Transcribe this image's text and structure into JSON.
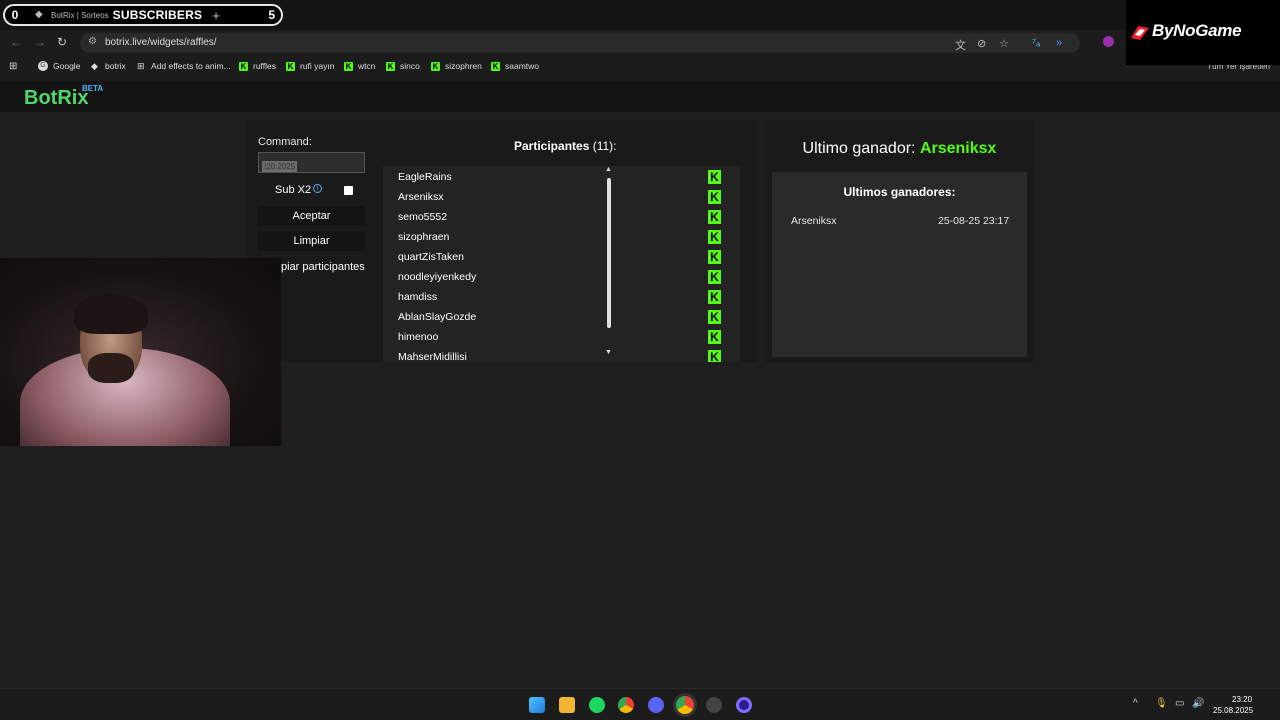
{
  "browser": {
    "subscribers_overlay": {
      "left_count": "0",
      "label": "SUBSCRIBERS",
      "right_count": "5"
    },
    "tab": {
      "title": "BotRix | Sorteos",
      "new_tab": "+"
    },
    "nav": {
      "back": "←",
      "forward": "→",
      "reload": "↻"
    },
    "url": "botrix.live/widgets/raffles/",
    "bookmarks": [
      {
        "label": "Google",
        "icon": "google-icon"
      },
      {
        "label": "botrix",
        "icon": "diamond-icon"
      },
      {
        "label": "Add effects to anim...",
        "icon": "plus-square-icon"
      },
      {
        "label": "ruffles",
        "icon": "kick-icon"
      },
      {
        "label": "rufi yayın",
        "icon": "kick-icon"
      },
      {
        "label": "wtcn",
        "icon": "kick-icon"
      },
      {
        "label": "sinco",
        "icon": "kick-icon"
      },
      {
        "label": "sizophren",
        "icon": "kick-icon"
      },
      {
        "label": "saamtwo",
        "icon": "kick-icon"
      }
    ],
    "all_bookmarks": "Tüm Yer İşaretleri"
  },
  "overlay_logo": {
    "text": "ByNoGame"
  },
  "app": {
    "brand": "BotRix",
    "beta": "BETA"
  },
  "raffle": {
    "command_label": "Command:",
    "command_value": "!20.2025",
    "sub_x2_label": "Sub X2",
    "info_glyph": "i",
    "accept_button": "Aceptar",
    "clear_button": "Limpiar",
    "clear_participants_partial": "piar participantes",
    "participants_title": "Participantes",
    "participants_count": "(11):",
    "kick_glyph": "K",
    "participants": [
      "EagleRains",
      "Arseniksx",
      "semo5552",
      "sizophraen",
      "quartZisTaken",
      "noodleyiyenkedy",
      "hamdiss",
      "AblanSlayGozde",
      "himenoo",
      "MahserMidillisi"
    ]
  },
  "winner": {
    "title_prefix": "Ultimo ganador:",
    "name": "Arseniksx",
    "history_title": "Ultimos ganadores:",
    "history": [
      {
        "name": "Arseniksx",
        "time": "25-08-25 23:17"
      }
    ]
  },
  "taskbar": {
    "time": "23:20",
    "date": "25.08.2025",
    "tray_up": "^"
  },
  "colors": {
    "kick_green": "#53fc18",
    "brand_green": "#53d76a",
    "beta_blue": "#4db3ff"
  }
}
